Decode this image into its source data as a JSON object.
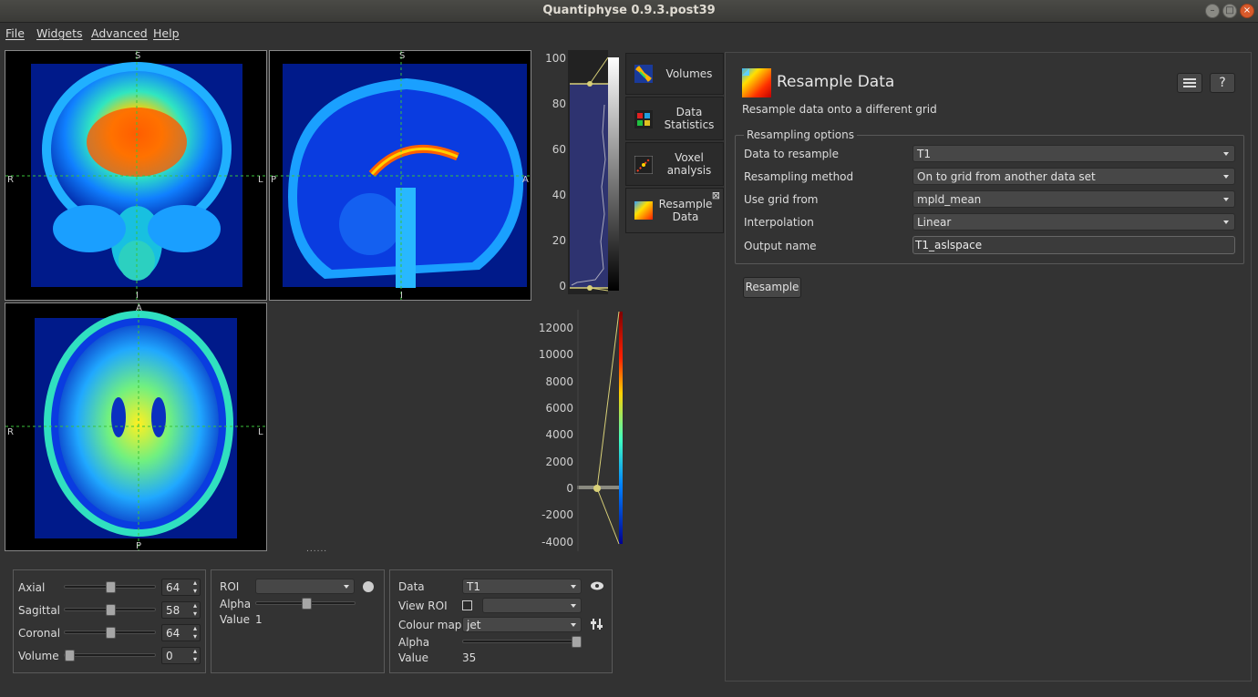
{
  "window": {
    "title": "Quantiphyse 0.9.3.post39"
  },
  "menu": [
    "File",
    "Widgets",
    "Advanced",
    "Help"
  ],
  "views": {
    "coronal": {
      "top": "S",
      "bottom": "I",
      "left": "R",
      "right": "L"
    },
    "sagittal": {
      "top": "S",
      "bottom": "I",
      "left": "P",
      "right": "A"
    },
    "axial": {
      "top": "A",
      "bottom": "P",
      "left": "R",
      "right": "L"
    }
  },
  "histogram": {
    "ticks": [
      "100",
      "80",
      "60",
      "40",
      "20",
      "0"
    ]
  },
  "colormap_levels": {
    "ticks": [
      "12000",
      "10000",
      "8000",
      "6000",
      "4000",
      "2000",
      "0",
      "-2000",
      "-4000"
    ]
  },
  "splitter_handle": "......",
  "tabs": [
    {
      "label": "Volumes",
      "icon": "volumes-icon"
    },
    {
      "label": "Data Statistics",
      "line1": "Data",
      "line2": "Statistics",
      "icon": "data-statistics-icon"
    },
    {
      "label": "Voxel analysis",
      "line1": "Voxel",
      "line2": "analysis",
      "icon": "voxel-analysis-icon"
    },
    {
      "label": "Resample Data",
      "line1": "Resample",
      "line2": "Data",
      "icon": "resample-icon",
      "active": true,
      "close": "⊠"
    }
  ],
  "resample_panel": {
    "title": "Resample Data",
    "description": "Resample data onto a different grid",
    "group_title": "Resampling options",
    "fields": {
      "data": {
        "label": "Data to resample",
        "value": "T1"
      },
      "method": {
        "label": "Resampling method",
        "value": "On to grid from another data set"
      },
      "grid": {
        "label": "Use grid from",
        "value": "mpld_mean"
      },
      "interp": {
        "label": "Interpolation",
        "value": "Linear"
      },
      "output": {
        "label": "Output name",
        "value": "T1_aslspace"
      }
    },
    "button": "Resample",
    "menu_icon": "list-icon",
    "help_label": "?"
  },
  "navigation": {
    "axial": {
      "label": "Axial",
      "value": "64",
      "slider": 0.5
    },
    "sagittal": {
      "label": "Sagittal",
      "value": "58",
      "slider": 0.5
    },
    "coronal": {
      "label": "Coronal",
      "value": "64",
      "slider": 0.5
    },
    "volume": {
      "label": "Volume",
      "value": "0",
      "slider": 0.0
    }
  },
  "roi_box": {
    "roi_label": "ROI",
    "roi_value": "",
    "alpha_label": "Alpha",
    "alpha": 0.5,
    "value_label": "Value",
    "value": "1"
  },
  "data_box": {
    "data_label": "Data",
    "data_value": "T1",
    "view_roi_label": "View ROI",
    "view_roi_value": "",
    "colour_map_label": "Colour map",
    "colour_map_value": "jet",
    "alpha_label": "Alpha",
    "alpha": 1.0,
    "value_label": "Value",
    "value": "35"
  }
}
